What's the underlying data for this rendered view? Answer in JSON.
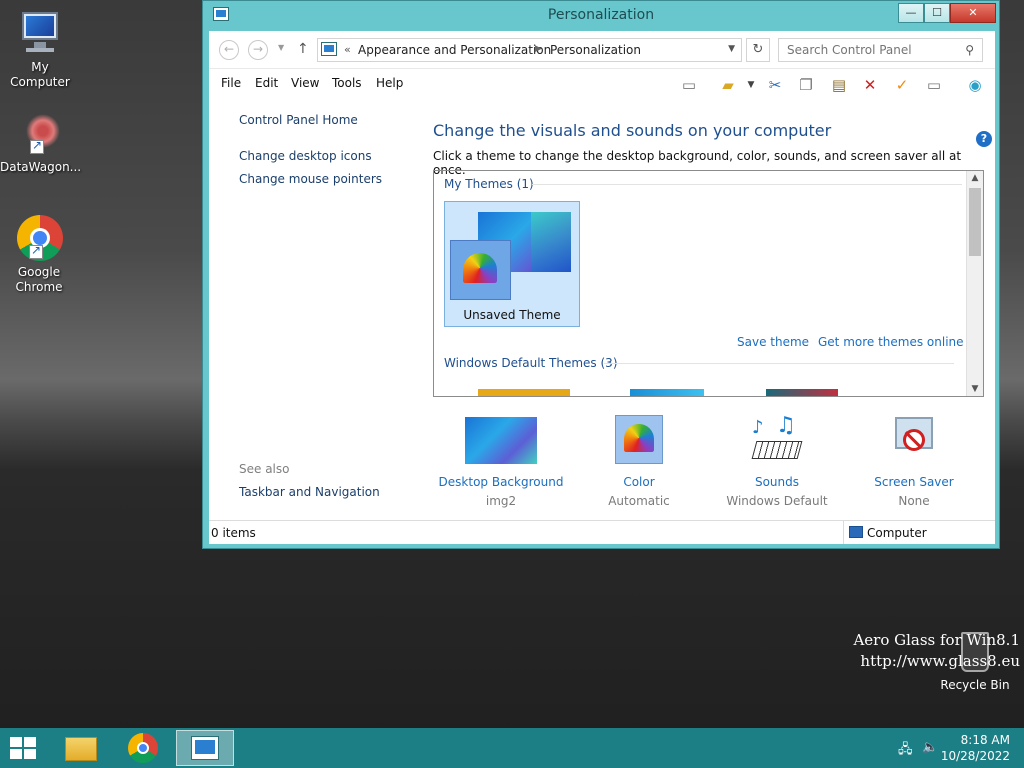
{
  "desktop": {
    "icons": [
      {
        "label": "My Computer"
      },
      {
        "label": "DataWagon..."
      },
      {
        "label": "Google Chrome"
      }
    ],
    "watermark_line1": "Aero Glass for Win8.1",
    "watermark_line2": "http://www.glass8.eu",
    "recycle_label": "Recycle Bin"
  },
  "window": {
    "title": "Personalization",
    "btn_min": "—",
    "btn_max": "☐",
    "btn_close": "✕"
  },
  "address": {
    "sep": "«",
    "crumb1": "Appearance and Personalization",
    "crumb2": "Personalization",
    "search_placeholder": "Search Control Panel"
  },
  "menu": [
    "File",
    "Edit",
    "View",
    "Tools",
    "Help"
  ],
  "left_pane": {
    "home": "Control Panel Home",
    "links": [
      "Change desktop icons",
      "Change mouse pointers"
    ],
    "see_also": "See also",
    "see_also_links": [
      "Taskbar and Navigation"
    ]
  },
  "main": {
    "heading": "Change the visuals and sounds on your computer",
    "subheading": "Click a theme to change the desktop background, color, sounds, and screen saver all at once.",
    "group1": "My Themes (1)",
    "group2": "Windows Default Themes (3)",
    "selected_theme": "Unsaved Theme",
    "save_theme": "Save theme",
    "more_themes": "Get more themes online"
  },
  "settings": [
    {
      "label": "Desktop Background",
      "value": "img2"
    },
    {
      "label": "Color",
      "value": "Automatic"
    },
    {
      "label": "Sounds",
      "value": "Windows Default"
    },
    {
      "label": "Screen Saver",
      "value": "None"
    }
  ],
  "status": {
    "items": "0 items",
    "location": "Computer"
  },
  "clock": {
    "time": "8:18 AM",
    "date": "10/28/2022"
  },
  "colors": {
    "window_frame": "#67c7cd",
    "taskbar": "#1d7f86",
    "link": "#1b6fc0",
    "heading": "#1f4f8f"
  }
}
